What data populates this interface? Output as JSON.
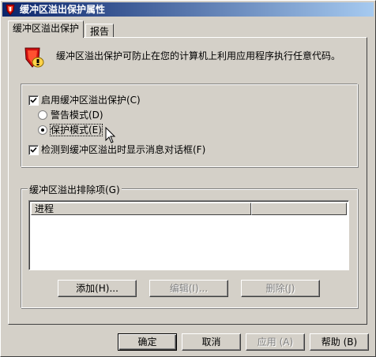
{
  "window": {
    "title": "缓冲区溢出保护属性"
  },
  "tabs": [
    {
      "label": "缓冲区溢出保护",
      "active": true
    },
    {
      "label": "报告",
      "active": false
    }
  ],
  "info": {
    "icon": "shield-warning-icon",
    "text": "缓冲区溢出保护可防止在您的计算机上利用应用程序执行任意代码。"
  },
  "protection": {
    "enable_label": "启用缓冲区溢出保护(C)",
    "enable_checked": true,
    "warn_mode_label": "警告模式(D)",
    "protect_mode_label": "保护模式(E)",
    "selected_mode": "protect",
    "show_dialog_label": "检测到缓冲区溢出时显示消息对话框(F)",
    "show_dialog_checked": true
  },
  "exclusions": {
    "group_title": "缓冲区溢出排除项(G)",
    "column_process": "进程",
    "rows": [],
    "add_label": "添加(H)...",
    "edit_label": "编辑(I)...",
    "delete_label": "删除(J)"
  },
  "footer": {
    "ok_label": "确定",
    "cancel_label": "取消",
    "apply_label": "应用 (A)",
    "help_label": "帮助 (B)"
  },
  "colors": {
    "titlebar_start": "#0a246a",
    "titlebar_end": "#a6caf0",
    "face": "#d4d0c8"
  }
}
